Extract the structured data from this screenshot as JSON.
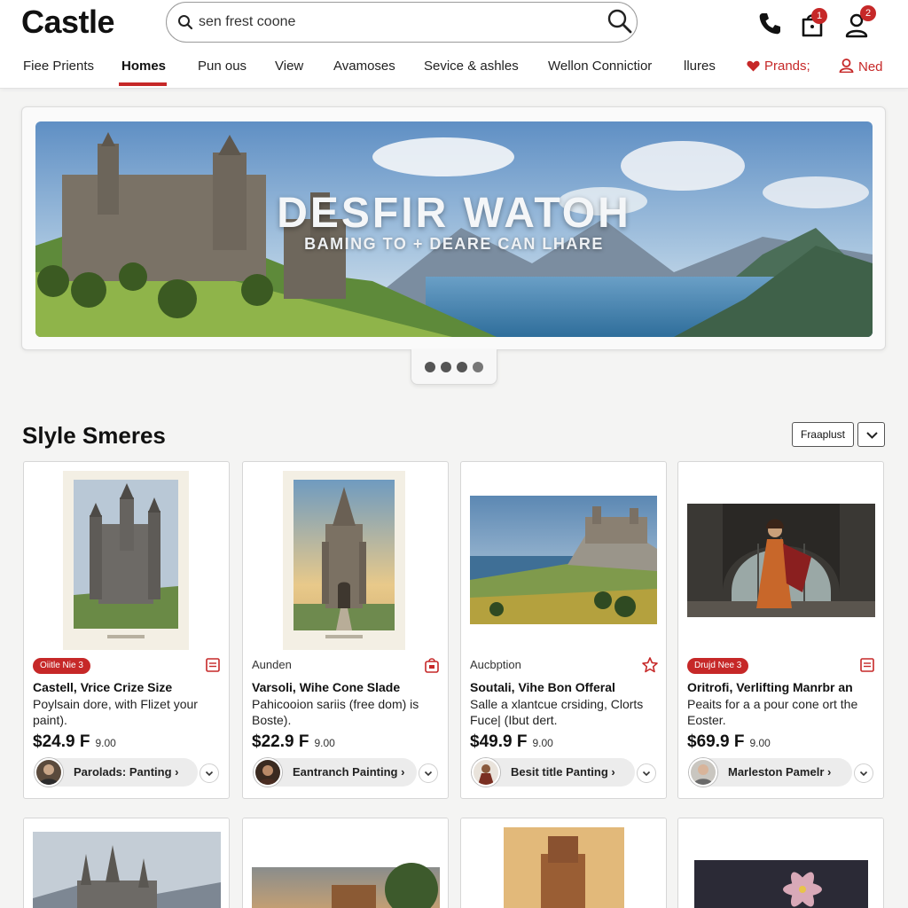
{
  "header": {
    "logo": "Castle",
    "search_value": "sen frest coone",
    "cart_badge": "1",
    "account_badge": "2"
  },
  "nav": {
    "items": [
      "Fiee Prients",
      "Homes",
      "Pun ous",
      "View",
      "Avamoses",
      "Sevice & ashles",
      "Wellon Connictior",
      "llures"
    ],
    "active": "Homes",
    "favorites_label": "Prands;",
    "user_label": "Ned"
  },
  "hero": {
    "title": "DESFIR WATOH",
    "subtitle": "BAMING TO + DEARE CAN LHARE"
  },
  "section": {
    "title": "Slyle Smeres",
    "sort_label": "Fraaplust"
  },
  "products": [
    {
      "tag": "Oiitle Nie 3",
      "tag_style": "pill",
      "title": "Castell, Vrice Crize Size",
      "desc": "Poylsain dore, with Flizet your paint).",
      "price": "$24.9 F",
      "price_sub": "9.00",
      "artist": "Parolads: Panting",
      "icon": "bookmark-icon"
    },
    {
      "tag": "Aunden",
      "tag_style": "text",
      "title": "Varsoli, Wihe Cone Slade",
      "desc": "Pahicooion sariis (free dom) is Boste).",
      "price": "$22.9 F",
      "price_sub": "9.00",
      "artist": "Eantranch Painting",
      "icon": "bag-icon"
    },
    {
      "tag": "Aucbption",
      "tag_style": "text",
      "title": "Soutali, Vihe Bon Offeral",
      "desc": "Salle a xlantcue crsiding, Clorts Fuce| (Ibut dert.",
      "price": "$49.9 F",
      "price_sub": "9.00",
      "artist": "Besit title Panting",
      "icon": "star-icon"
    },
    {
      "tag": "Drujd Nee 3",
      "tag_style": "pill",
      "title": "Oritrofi, Verlifting Manrbr an",
      "desc": "Peaits for a a pour cone ort the Eoster.",
      "price": "$69.9 F",
      "price_sub": "9.00",
      "artist": "Marleston Pamelr",
      "icon": "bookmark-icon"
    }
  ],
  "colors": {
    "accent": "#c62828",
    "text": "#111111",
    "background": "#f4f4f3"
  }
}
